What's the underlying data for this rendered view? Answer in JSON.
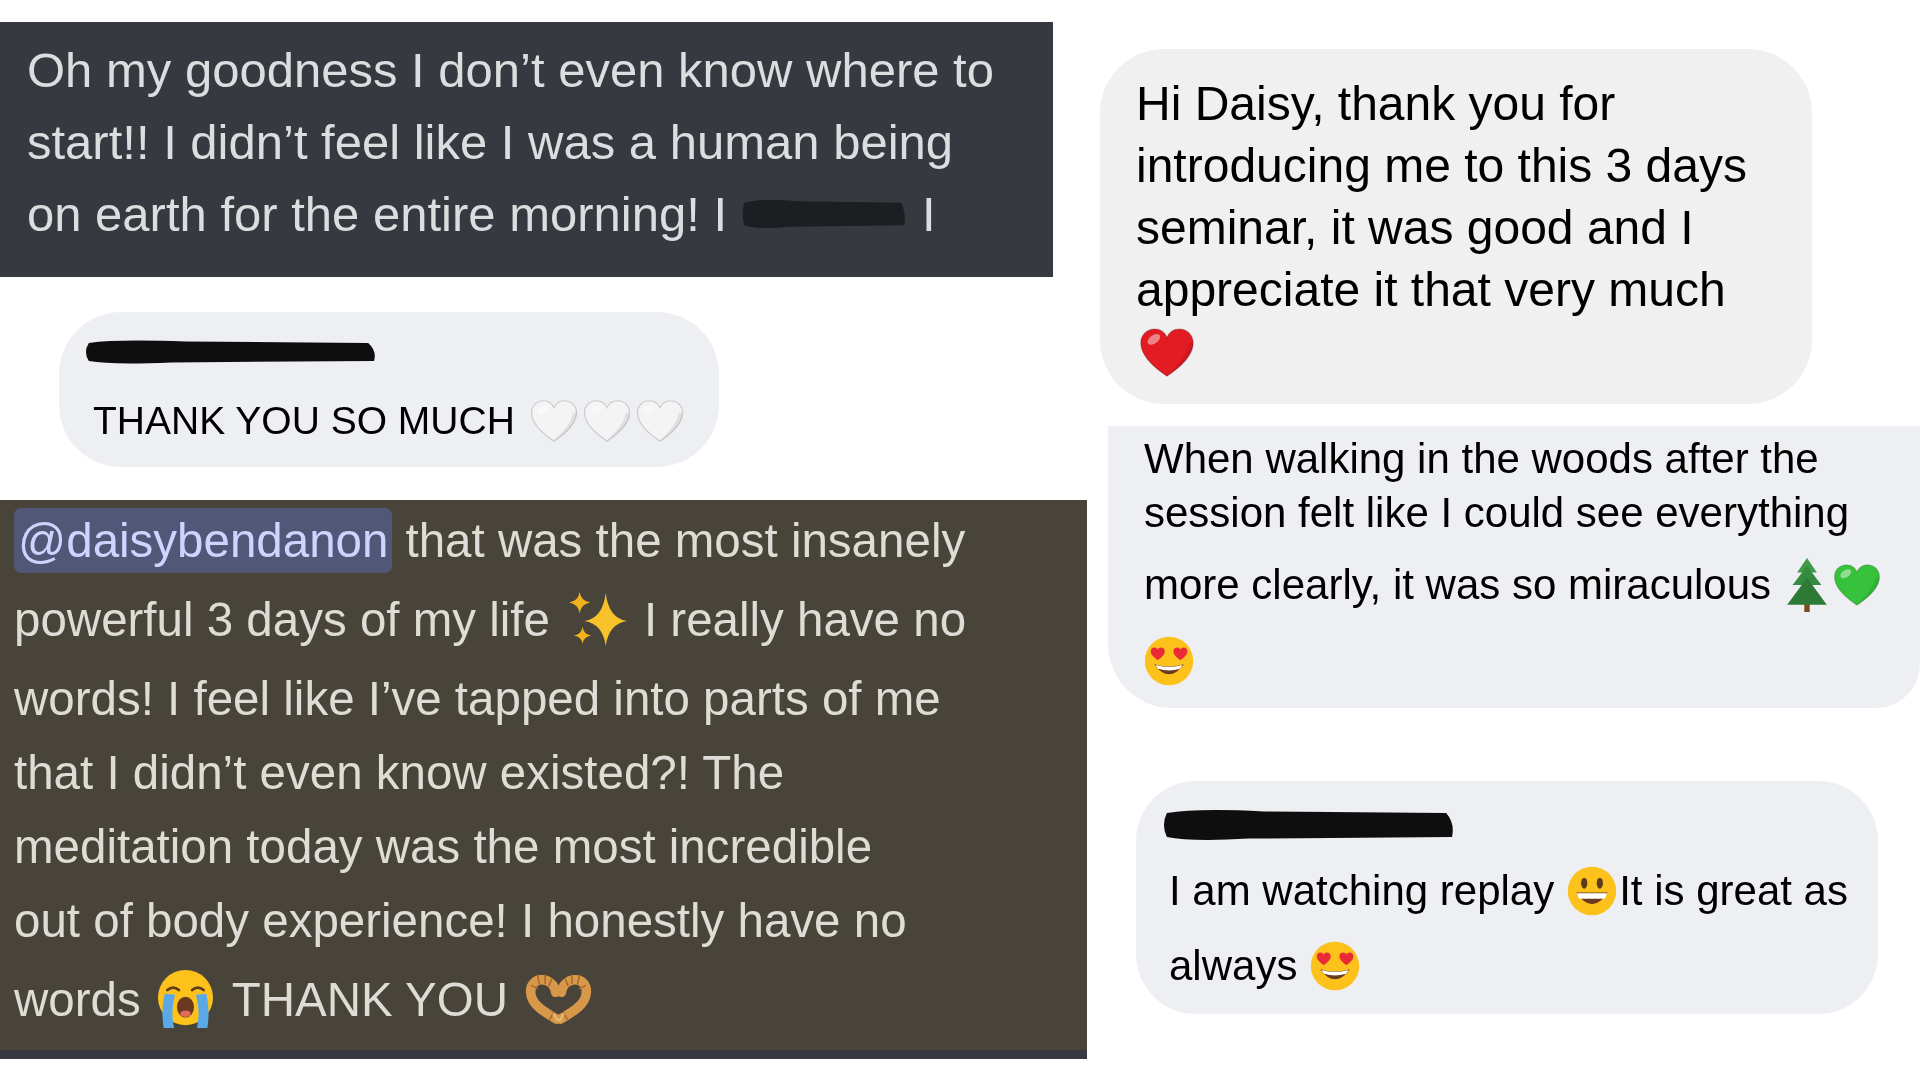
{
  "left_column": {
    "messages": [
      {
        "kind": "discord",
        "highlighted": false,
        "lines": [
          [
            {
              "kind": "text",
              "text": "Oh my goodness I don’t even know where to"
            }
          ],
          [
            {
              "kind": "text",
              "text": "start!! I didn’t feel like I was a human being"
            }
          ],
          [
            {
              "kind": "text",
              "text": "on earth for the entire morning! I"
            },
            {
              "kind": "redaction"
            },
            {
              "kind": "text",
              "text": "I"
            }
          ]
        ]
      },
      {
        "kind": "bubble",
        "lines": [
          [
            {
              "kind": "redaction"
            }
          ],
          [
            {
              "kind": "text",
              "text": "THANK YOU SO MUCH"
            },
            {
              "kind": "heart",
              "color": "#f4f4f4"
            },
            {
              "kind": "heart",
              "color": "#f4f4f4"
            },
            {
              "kind": "heart",
              "color": "#f4f4f4"
            }
          ]
        ]
      },
      {
        "kind": "discord",
        "highlighted": true,
        "lines": [
          [
            {
              "kind": "mention",
              "text": "@daisybendanon"
            },
            {
              "kind": "text",
              "text": "that was the most insanely"
            }
          ],
          [
            {
              "kind": "text",
              "text": "powerful 3 days of my life"
            },
            {
              "kind": "sparkles"
            },
            {
              "kind": "text",
              "text": "I really have no"
            }
          ],
          [
            {
              "kind": "text",
              "text": "words! I feel like I’ve tapped into parts of me"
            }
          ],
          [
            {
              "kind": "text",
              "text": "that I didn’t even know existed?! The"
            }
          ],
          [
            {
              "kind": "text",
              "text": "meditation today was the most incredible"
            }
          ],
          [
            {
              "kind": "text",
              "text": "out of body experience! I honestly have no"
            }
          ],
          [
            {
              "kind": "text",
              "text": "words"
            },
            {
              "kind": "crying-face"
            },
            {
              "kind": "text",
              "text": "THANK YOU"
            },
            {
              "kind": "heart-hands"
            }
          ]
        ]
      }
    ]
  },
  "right_column": {
    "messages": [
      {
        "kind": "bubble",
        "lines": [
          [
            {
              "kind": "text",
              "text": "Hi Daisy, thank you for"
            }
          ],
          [
            {
              "kind": "text",
              "text": "introducing me to this 3 days"
            }
          ],
          [
            {
              "kind": "text",
              "text": "seminar, it was good and I"
            }
          ],
          [
            {
              "kind": "text",
              "text": "appreciate it that very much"
            }
          ],
          [
            {
              "kind": "heart",
              "color": "#e31b23"
            }
          ]
        ]
      },
      {
        "kind": "bubble",
        "lines": [
          [
            {
              "kind": "text",
              "text": "When walking in the woods after the"
            }
          ],
          [
            {
              "kind": "text",
              "text": "session felt like I could see everything"
            }
          ],
          [
            {
              "kind": "text",
              "text": "more clearly, it was so miraculous"
            },
            {
              "kind": "evergreen-tree"
            },
            {
              "kind": "heart",
              "color": "#36c23b"
            }
          ],
          [
            {
              "kind": "heart-eyes"
            }
          ]
        ]
      },
      {
        "kind": "bubble",
        "lines": [
          [
            {
              "kind": "redaction"
            }
          ],
          [
            {
              "kind": "text",
              "text": "I am watching replay"
            },
            {
              "kind": "smiley"
            },
            {
              "kind": "text",
              "text": "It is great as"
            }
          ],
          [
            {
              "kind": "text",
              "text": "always"
            },
            {
              "kind": "heart-eyes"
            }
          ]
        ]
      }
    ]
  }
}
